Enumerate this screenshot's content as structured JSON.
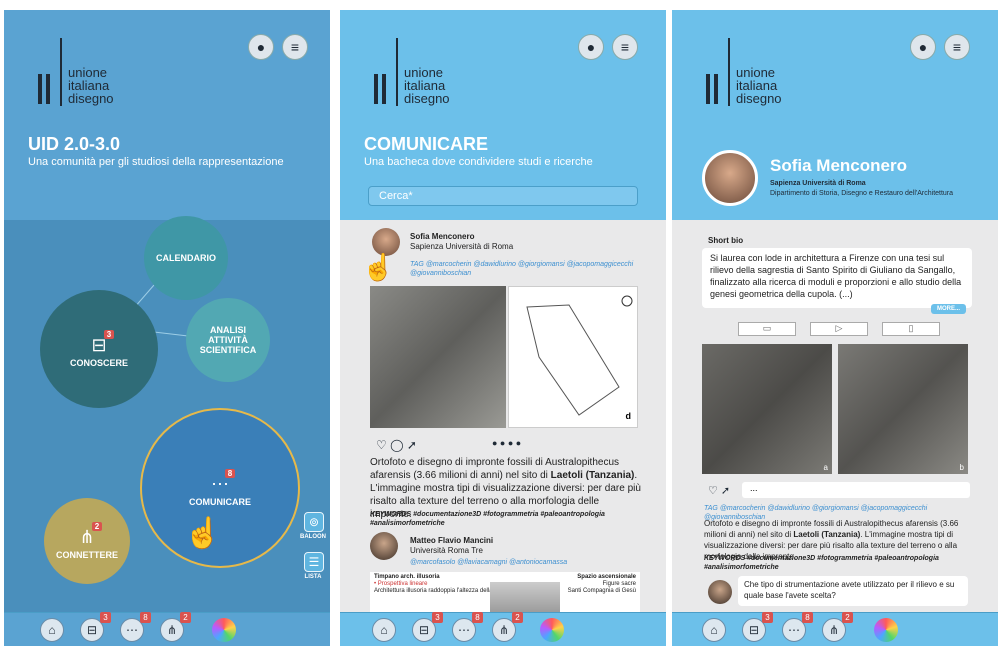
{
  "logo": {
    "line1": "unione",
    "line2": "italiana",
    "line3": "disegno"
  },
  "screen1": {
    "title": "UID 2.0-3.0",
    "subtitle": "Una comunità per gli studiosi della rappresentazione",
    "circles": {
      "calendario": "CALENDARIO",
      "conoscere": "CONOSCERE",
      "conoscere_badge": "3",
      "analisi": "ANALISI ATTIVITÀ SCIENTIFICA",
      "comunicare": "COMUNICARE",
      "comunicare_badge": "8",
      "connettere": "CONNETTERE",
      "connettere_badge": "2"
    },
    "side": {
      "baloon": "BALOON",
      "lista": "LISTA"
    }
  },
  "screen2": {
    "title": "COMUNICARE",
    "subtitle": "Una bacheca dove condividere studi e ricerche",
    "search_placeholder": "Cerca*",
    "post1": {
      "author": "Sofia Menconero",
      "affiliation": "Sapienza Università di Roma",
      "tags": "TAG @marcocherin @dawidlurino @giorgiomansi @jacopomaggicecchi @giovanniboschian",
      "figure_label": "d",
      "body_a": "Ortofoto e disegno di impronte fossili di Australopithecus afarensis (3.66 milioni di anni) nel sito di ",
      "body_bold": "Laetoli (Tanzania)",
      "body_b": ". L'immagine mostra tipi di visualizzazione diversi: per dare più risalto alla texture del terreno o alla morfologia delle impronte.",
      "keywords": "KEYWORDS #documentazione3D #fotogrammetria #paleoantropologia #analisimorfometriche"
    },
    "post2": {
      "author": "Matteo Flavio Mancini",
      "affiliation": "Università Roma Tre",
      "tags": "@marcofasolo @flaviacamagni @antoniocamassa",
      "caption_left_1": "Timpano arch. illusoria",
      "caption_left_2": "• Prospettiva lineare",
      "caption_left_3": "Architettura illusoria raddoppia l'altezza della navata",
      "caption_right_1": "Spazio ascensionale",
      "caption_right_2": "Figure sacre",
      "caption_right_3": "Santi Compagnia di Gesù"
    }
  },
  "screen3": {
    "name": "Sofia Menconero",
    "university": "Sapienza Università di Roma",
    "department": "Dipartimento di Storia, Disegno e Restauro dell'Architettura",
    "bio_label": "Short bio",
    "bio": "Si laurea con lode in architettura a Firenze con una tesi sul rilievo della sagrestia di Santo Spirito di Giuliano da Sangallo, finalizzato alla ricerca di moduli e proporzioni e allo studio della genesi geometrica della cupola. (...)",
    "more": "MORE...",
    "img_label_a": "a",
    "img_label_b": "b",
    "comment_placeholder": "...",
    "tags": "TAG @marcocherin @dawidlurino @giorgiomansi @jacopomaggicecchi @giovanniboschian",
    "body_a": "Ortofoto e disegno di impronte fossili di Australopithecus afarensis (3.66 milioni di anni) nel sito di ",
    "body_bold": "Laetoli (Tanzania)",
    "body_b": ". L'immagine mostra tipi di visualizzazione diversi: per dare più risalto alla texture del terreno o alla morfologia delle impronte.",
    "keywords": "KEYWORDS #documentazione3D #fotogrammetria #paleoantropologia #analisimorfometriche",
    "question": "Che tipo di strumentazione avete utilizzato per il rilievo e su quale base l'avete scelta?"
  },
  "nav": {
    "badge_conoscere": "3",
    "badge_comunicare": "8",
    "badge_connettere": "2"
  },
  "colors": {
    "header": "#6cc0ea",
    "home_bg": "#4a8fbc",
    "badge": "#d9534f",
    "ring": "#e6b94a"
  }
}
